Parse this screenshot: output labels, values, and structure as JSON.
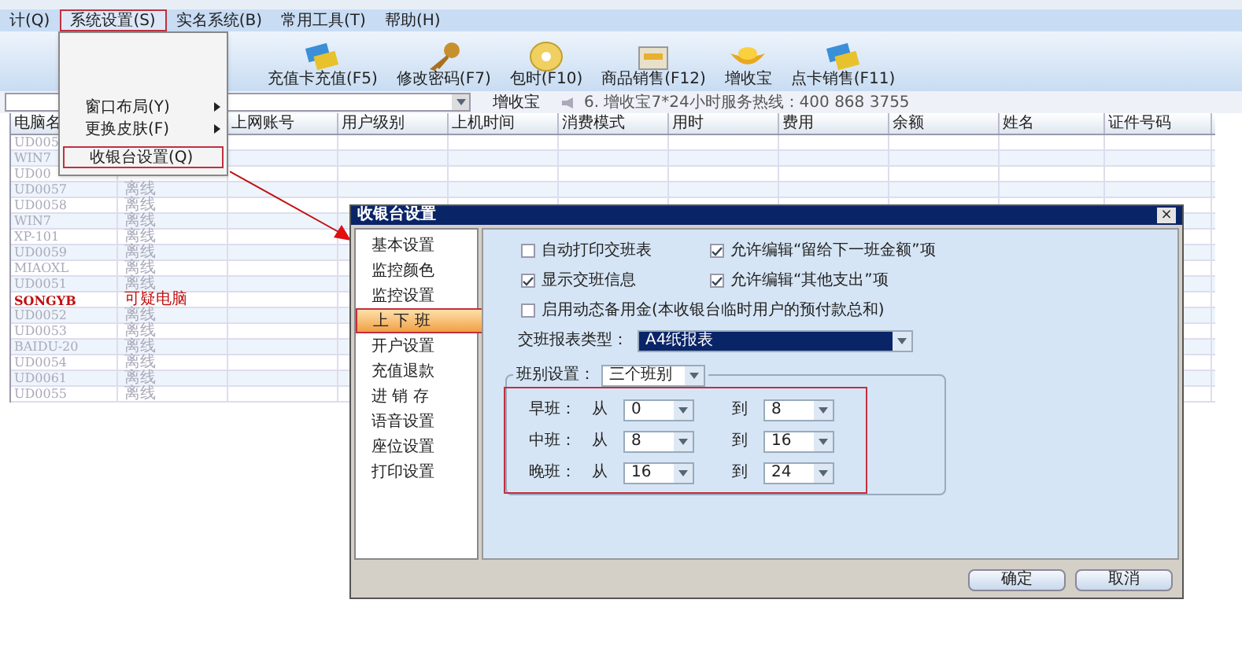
{
  "menu_bar": [
    {
      "label": "计(Q)",
      "selected": false
    },
    {
      "label": "系统设置(S)",
      "selected": true
    },
    {
      "label": "实名系统(B)",
      "selected": false
    },
    {
      "label": "常用工具(T)",
      "selected": false
    },
    {
      "label": "帮助(H)",
      "selected": false
    }
  ],
  "system_menu": {
    "items": [
      {
        "label": "窗口布局(Y)",
        "submenu": true,
        "highlighted": false
      },
      {
        "label": "更换皮肤(F)",
        "submenu": true,
        "highlighted": false
      },
      {
        "label": "收银台设置(Q)",
        "submenu": false,
        "highlighted": true
      }
    ]
  },
  "toolbar": [
    {
      "label": "充值卡充值(F5)",
      "kind": "cards"
    },
    {
      "label": "修改密码(F7)",
      "kind": "keys"
    },
    {
      "label": "包时(F10)",
      "kind": "disc"
    },
    {
      "label": "商品销售(F12)",
      "kind": "box"
    },
    {
      "label": "增收宝",
      "kind": "ingot"
    },
    {
      "label": "点卡销售(F11)",
      "kind": "cards"
    }
  ],
  "address_bar": {
    "button": "增收宝",
    "notice": "6. 增收宝7*24小时服务热线：400 868 3755"
  },
  "table": {
    "columns": [
      "电脑名",
      "",
      "上网账号",
      "用户级别",
      "上机时间",
      "消费模式",
      "用时",
      "费用",
      "余额",
      "姓名",
      "证件号码"
    ],
    "rows": [
      {
        "name": "UD005",
        "status": "",
        "suspicious": false
      },
      {
        "name": "WIN7",
        "status": "",
        "suspicious": false
      },
      {
        "name": "UD00",
        "status": "",
        "suspicious": false
      },
      {
        "name": "UD0057",
        "status": "离线",
        "suspicious": false
      },
      {
        "name": "UD0058",
        "status": "离线",
        "suspicious": false
      },
      {
        "name": "WIN7",
        "status": "离线",
        "suspicious": false
      },
      {
        "name": "XP-101",
        "status": "离线",
        "suspicious": false
      },
      {
        "name": "UD0059",
        "status": "离线",
        "suspicious": false
      },
      {
        "name": "MIAOXL",
        "status": "离线",
        "suspicious": false
      },
      {
        "name": "UD0051",
        "status": "离线",
        "suspicious": false
      },
      {
        "name": "SONGYB",
        "status": "可疑电脑",
        "suspicious": true
      },
      {
        "name": "UD0052",
        "status": "离线",
        "suspicious": false
      },
      {
        "name": "UD0053",
        "status": "离线",
        "suspicious": false
      },
      {
        "name": "BAIDU-20",
        "status": "离线",
        "suspicious": false
      },
      {
        "name": "UD0054",
        "status": "离线",
        "suspicious": false
      },
      {
        "name": "UD0061",
        "status": "离线",
        "suspicious": false
      },
      {
        "name": "UD0055",
        "status": "离线",
        "suspicious": false
      }
    ]
  },
  "dialog": {
    "title": "收银台设置",
    "close": "×",
    "nav": [
      {
        "label": "基本设置",
        "selected": false
      },
      {
        "label": "监控颜色",
        "selected": false
      },
      {
        "label": "监控设置",
        "selected": false
      },
      {
        "label": "上 下 班",
        "selected": true
      },
      {
        "label": "开户设置",
        "selected": false
      },
      {
        "label": "充值退款",
        "selected": false
      },
      {
        "label": "进 销 存",
        "selected": false
      },
      {
        "label": "语音设置",
        "selected": false
      },
      {
        "label": "座位设置",
        "selected": false
      },
      {
        "label": "打印设置",
        "selected": false
      }
    ],
    "options": [
      {
        "label": "自动打印交班表",
        "checked": false
      },
      {
        "label": "允许编辑“留给下一班金额”项",
        "checked": true
      },
      {
        "label": "显示交班信息",
        "checked": true
      },
      {
        "label": "允许编辑“其他支出”项",
        "checked": true
      },
      {
        "label": "启用动态备用金(本收银台临时用户的预付款总和)",
        "checked": false
      }
    ],
    "report_type": {
      "label": "交班报表类型：",
      "value": "A4纸报表"
    },
    "shift_group": {
      "label": "班别设置：",
      "value": "三个班别",
      "shifts": [
        {
          "name": "早班：",
          "from_label": "从",
          "from": "0",
          "to_label": "到",
          "to": "8"
        },
        {
          "name": "中班：",
          "from_label": "从",
          "from": "8",
          "to_label": "到",
          "to": "16"
        },
        {
          "name": "晚班：",
          "from_label": "从",
          "from": "16",
          "to_label": "到",
          "to": "24"
        }
      ]
    },
    "buttons": [
      "确定",
      "取消"
    ]
  }
}
